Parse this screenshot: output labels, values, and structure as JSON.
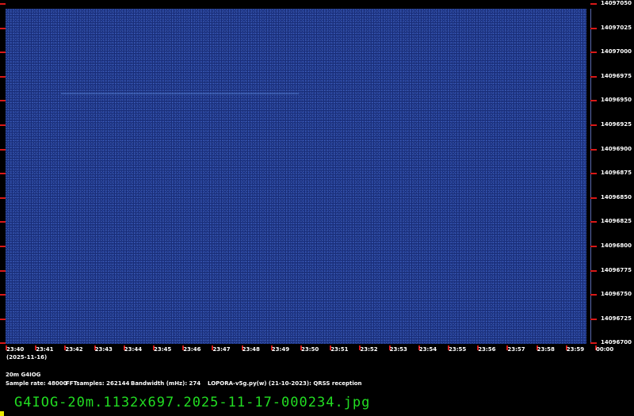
{
  "y_axis": {
    "labels": [
      "14097050",
      "14097025",
      "14097000",
      "14096975",
      "14096950",
      "14096925",
      "14096900",
      "14096875",
      "14096850",
      "14096825",
      "14096800",
      "14096775",
      "14096750",
      "14096725",
      "14096700"
    ]
  },
  "x_axis": {
    "labels": [
      "23:40",
      "23:41",
      "23:42",
      "23:43",
      "23:44",
      "23:45",
      "23:46",
      "23:47",
      "23:48",
      "23:49",
      "23:50",
      "23:51",
      "23:52",
      "23:53",
      "23:54",
      "23:55",
      "23:56",
      "23:57",
      "23:58",
      "23:59",
      "00:00"
    ],
    "date": "(2025-11-16)"
  },
  "info": {
    "band_call": "20m G4IOG",
    "sample_rate": "Sample rate: 48000",
    "fft_samples": "FFTsamples: 262144",
    "bandwidth": "Bandwidth (mHz): 274",
    "program": "LOPORA-v5g.py(w) (21-10-2023): QRSS reception"
  },
  "filename": "G4IOG-20m.1132x697.2025-11-17-000234.jpg",
  "colors": {
    "waterfall_bg": "#1a2f7a",
    "tick": "#d81818",
    "filename": "#22dd22",
    "cursor": "#e8e800"
  }
}
